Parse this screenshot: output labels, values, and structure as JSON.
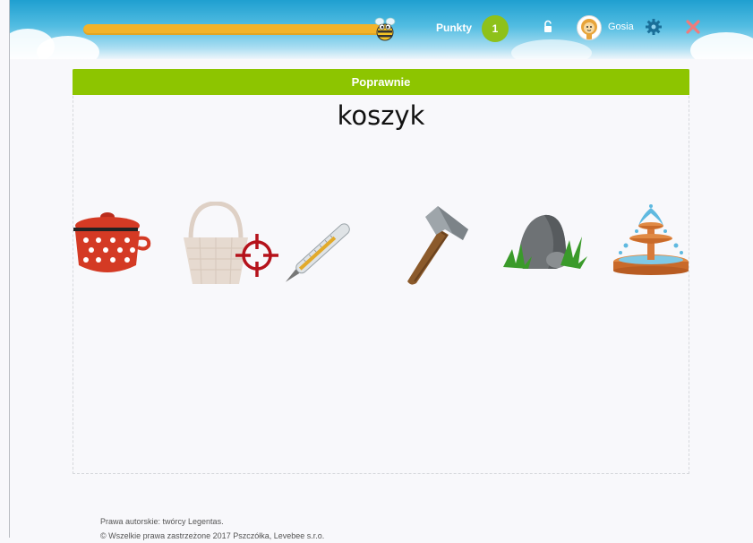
{
  "header": {
    "points_label": "Punkty",
    "points_value": "1",
    "username": "Gosia",
    "progress": 1.0,
    "icons": [
      "bee-icon",
      "lock-icon",
      "avatar-icon",
      "gear-icon",
      "close-icon"
    ]
  },
  "exercise": {
    "feedback": "Poprawnie",
    "word": "koszyk",
    "options": [
      {
        "name": "pot",
        "state": "normal"
      },
      {
        "name": "basket",
        "state": "correct-selected"
      },
      {
        "name": "thermometer",
        "state": "normal"
      },
      {
        "name": "hammer",
        "state": "normal"
      },
      {
        "name": "rock",
        "state": "normal"
      },
      {
        "name": "fountain",
        "state": "normal"
      }
    ]
  },
  "footer": {
    "line1": "Prawa autorskie: twórcy Legentas.",
    "line2": "© Wszelkie prawa zastrzeżone 2017 Pszczółka, Levebee s.r.o."
  },
  "colors": {
    "banner": "#8dc500",
    "points_badge": "#8ec11a",
    "progress": "#f3b32a",
    "gear": "#1a6f99",
    "close": "#f07b7b",
    "target": "#b5121b"
  }
}
